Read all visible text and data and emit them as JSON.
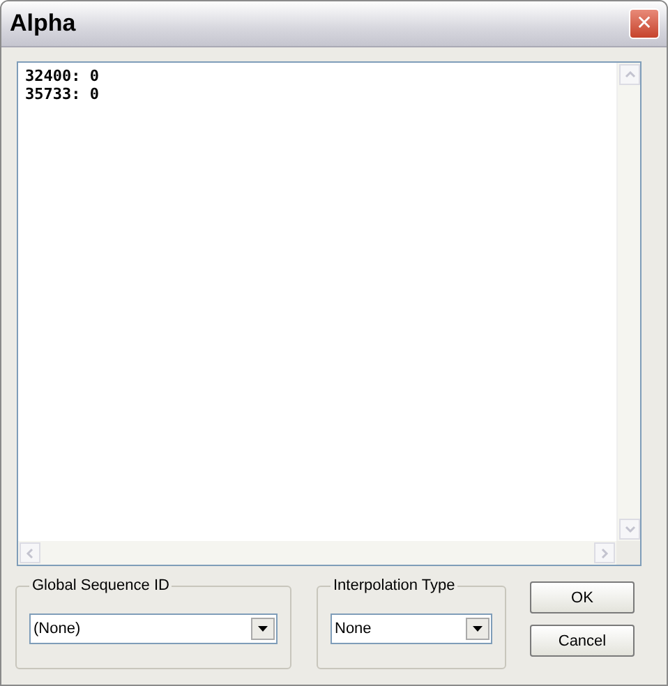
{
  "window": {
    "title": "Alpha",
    "close": "✕"
  },
  "editor": {
    "lines": [
      "32400: 0",
      "35733: 0"
    ]
  },
  "global_sequence": {
    "label": "Global Sequence ID",
    "value": "(None)"
  },
  "interpolation": {
    "label": "Interpolation Type",
    "value": "None"
  },
  "buttons": [
    "OK",
    "Cancel"
  ]
}
